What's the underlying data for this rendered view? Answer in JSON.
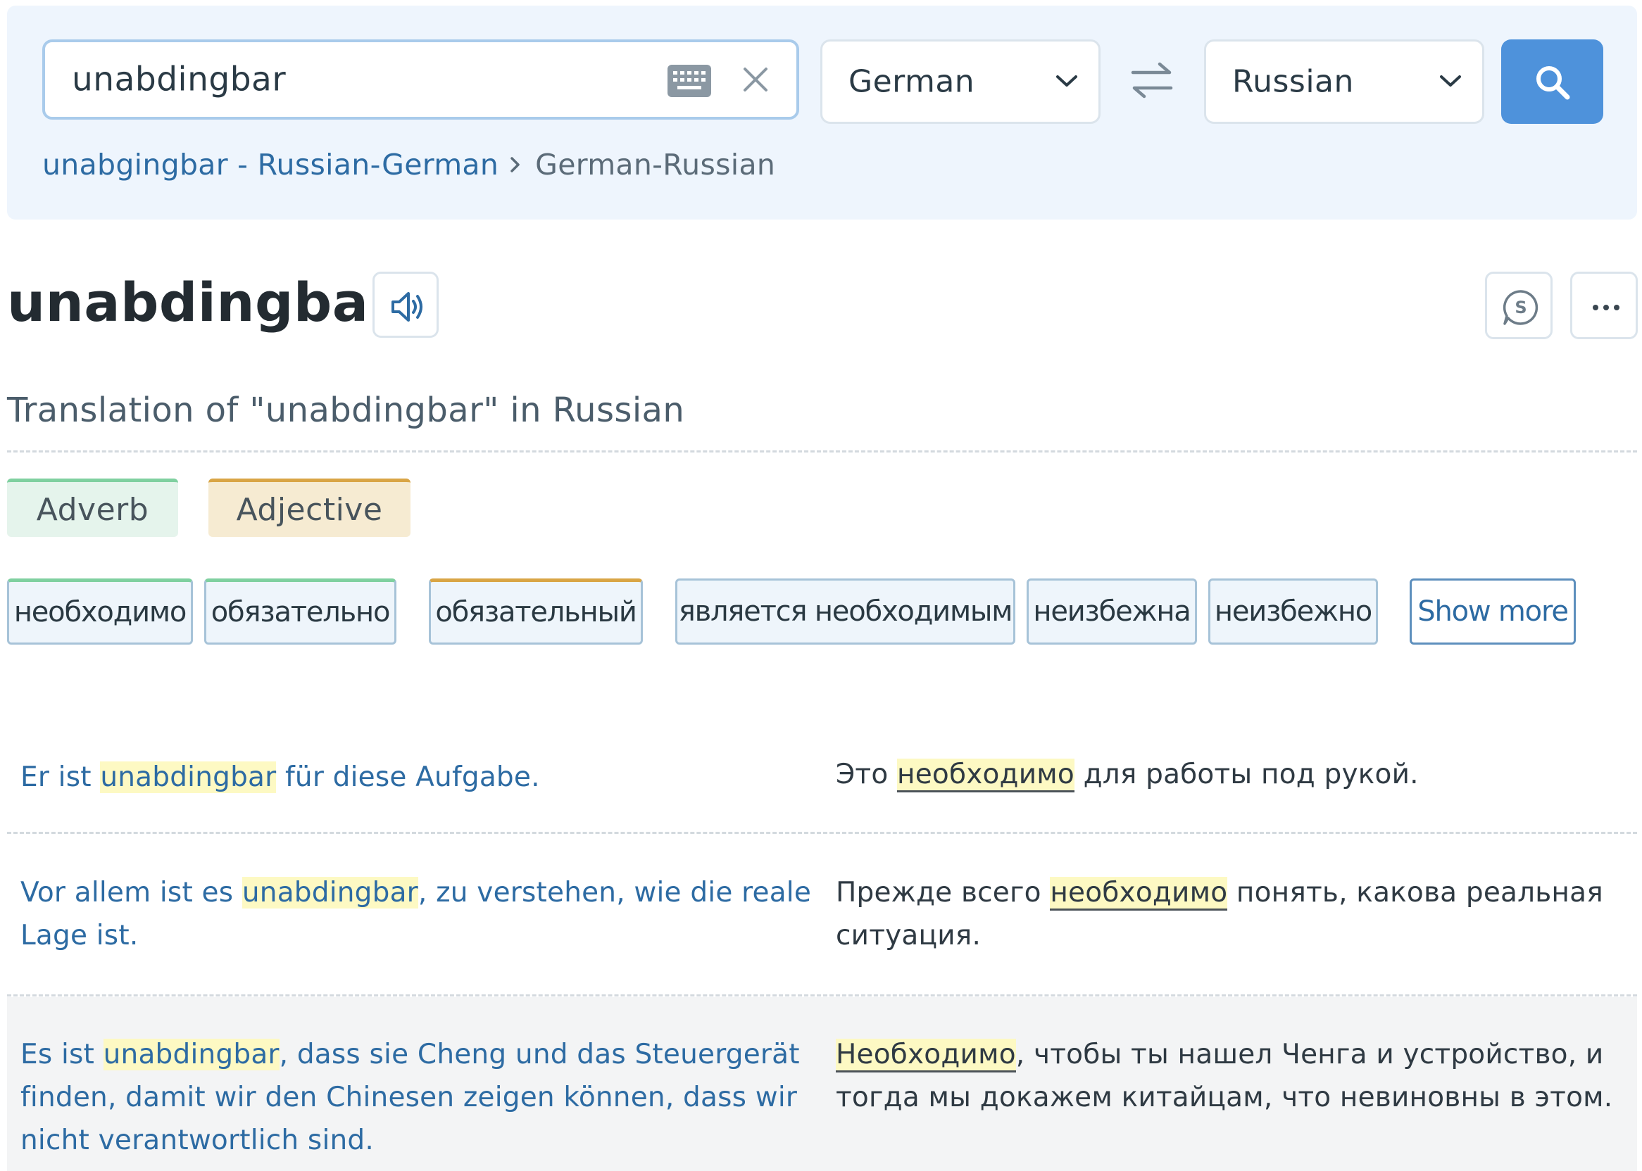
{
  "search": {
    "query": "unabdingbar",
    "keyboard_icon": "keyboard-icon",
    "clear_icon": "close-icon"
  },
  "languages": {
    "source": "German",
    "target": "Russian",
    "swap_icon": "swap-arrows-icon",
    "search_icon": "search-icon"
  },
  "breadcrumb": {
    "link": "unabgingbar - Russian-German",
    "current": "German-Russian"
  },
  "entry": {
    "headword": "unabdingbar",
    "subtitle": "Translation of \"unabdingbar\" in Russian",
    "audio_icon": "speaker-icon",
    "actions": [
      "skype-icon",
      "more-options-icon"
    ]
  },
  "parts_of_speech": [
    {
      "label": "Adverb",
      "color": "#7fd0a0",
      "bg": "#e5f4ec"
    },
    {
      "label": "Adjective",
      "color": "#d9a545",
      "bg": "#f6ebd2"
    }
  ],
  "translations": [
    {
      "label": "необходимо",
      "pos": "Adverb"
    },
    {
      "label": "обязательно",
      "pos": "Adverb"
    },
    {
      "label": "обязательный",
      "pos": "Adjective"
    },
    {
      "label": "является необходимым",
      "pos": ""
    },
    {
      "label": "неизбежна",
      "pos": ""
    },
    {
      "label": "неизбежно",
      "pos": ""
    }
  ],
  "show_more": "Show more",
  "examples": [
    {
      "de_before": "Er ist ",
      "de_hl": "unabdingbar",
      "de_after": " für diese Aufgabe.",
      "ru_before": "Это ",
      "ru_hl": "необходимо",
      "ru_after": " для работы под рукой."
    },
    {
      "de_before": "Vor allem ist es ",
      "de_hl": "unabdingbar",
      "de_after": ", zu verstehen, wie die reale Lage ist.",
      "ru_before": "Прежде всего ",
      "ru_hl": "необходимо",
      "ru_after": " понять, какова реальная ситуация."
    },
    {
      "de_before": "Es ist ",
      "de_hl": "unabdingbar",
      "de_after": ", dass sie Cheng und das Steuergerät finden, damit wir den Chinesen zeigen können, dass wir nicht verantwortlich sind.",
      "ru_before": "",
      "ru_hl": "Необходимо",
      "ru_after": ", чтобы ты нашел Ченга и устройство, и тогда мы докажем китайцам, что невиновны в этом."
    }
  ]
}
